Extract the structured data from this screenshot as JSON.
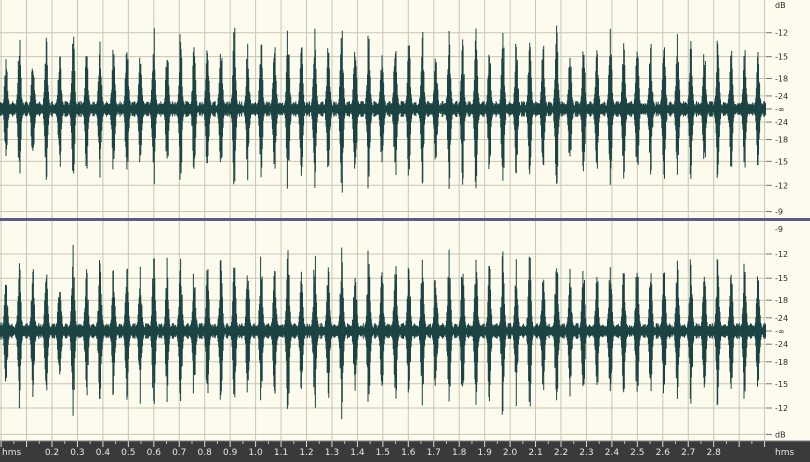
{
  "app": {
    "background_color": "#fdfbee",
    "waveform_color": "#1b4343",
    "grid_color": "#c9c6b0",
    "panel_border_color": "#5a5c8a",
    "ruler_background": "#3a3a3a",
    "ruler_text_color": "#e6e6e6"
  },
  "channels": [
    {
      "id": "left",
      "db_scale": {
        "top_label": "dB",
        "labels": [
          "-12",
          "-15",
          "-18",
          "-24",
          "-∞",
          "-24",
          "-18",
          "-15",
          "-12",
          "-9"
        ]
      }
    },
    {
      "id": "right",
      "db_scale": {
        "top_label": "-9",
        "labels": [
          "-12",
          "-15",
          "-18",
          "-24",
          "-∞",
          "-24",
          "-18",
          "-15",
          "-12",
          "dB"
        ]
      }
    }
  ],
  "timeline": {
    "unit_label_left": "hms",
    "unit_label_right": "hms",
    "tick_labels": [
      "0.2",
      "0.3",
      "0.4",
      "0.5",
      "0.6",
      "0.7",
      "0.8",
      "0.9",
      "1.0",
      "1.1",
      "1.2",
      "1.3",
      "1.4",
      "1.5",
      "1.6",
      "1.7",
      "1.8",
      "1.9",
      "2.0",
      "2.1",
      "2.2",
      "2.3",
      "2.4",
      "2.5",
      "2.6",
      "2.7",
      "2.8"
    ]
  },
  "waveform": {
    "pulse_count": 57,
    "peak_levels": [
      0.55,
      0.72,
      0.62,
      0.78,
      0.66,
      0.84,
      0.7,
      0.76,
      0.64,
      0.8,
      0.68,
      0.86,
      0.72,
      0.78,
      0.66,
      0.82,
      0.74,
      0.88,
      0.7,
      0.8,
      0.76,
      0.92,
      0.68,
      0.84,
      0.72,
      0.9,
      0.74,
      0.82,
      0.7,
      0.86,
      0.72,
      0.8,
      0.68,
      0.84,
      0.74,
      0.82,
      0.7,
      0.88,
      0.72,
      0.8,
      0.7,
      0.82,
      0.68,
      0.78,
      0.72,
      0.84,
      0.7,
      0.8,
      0.66,
      0.82,
      0.7,
      0.78,
      0.68,
      0.8,
      0.66,
      0.76,
      0.62
    ]
  }
}
